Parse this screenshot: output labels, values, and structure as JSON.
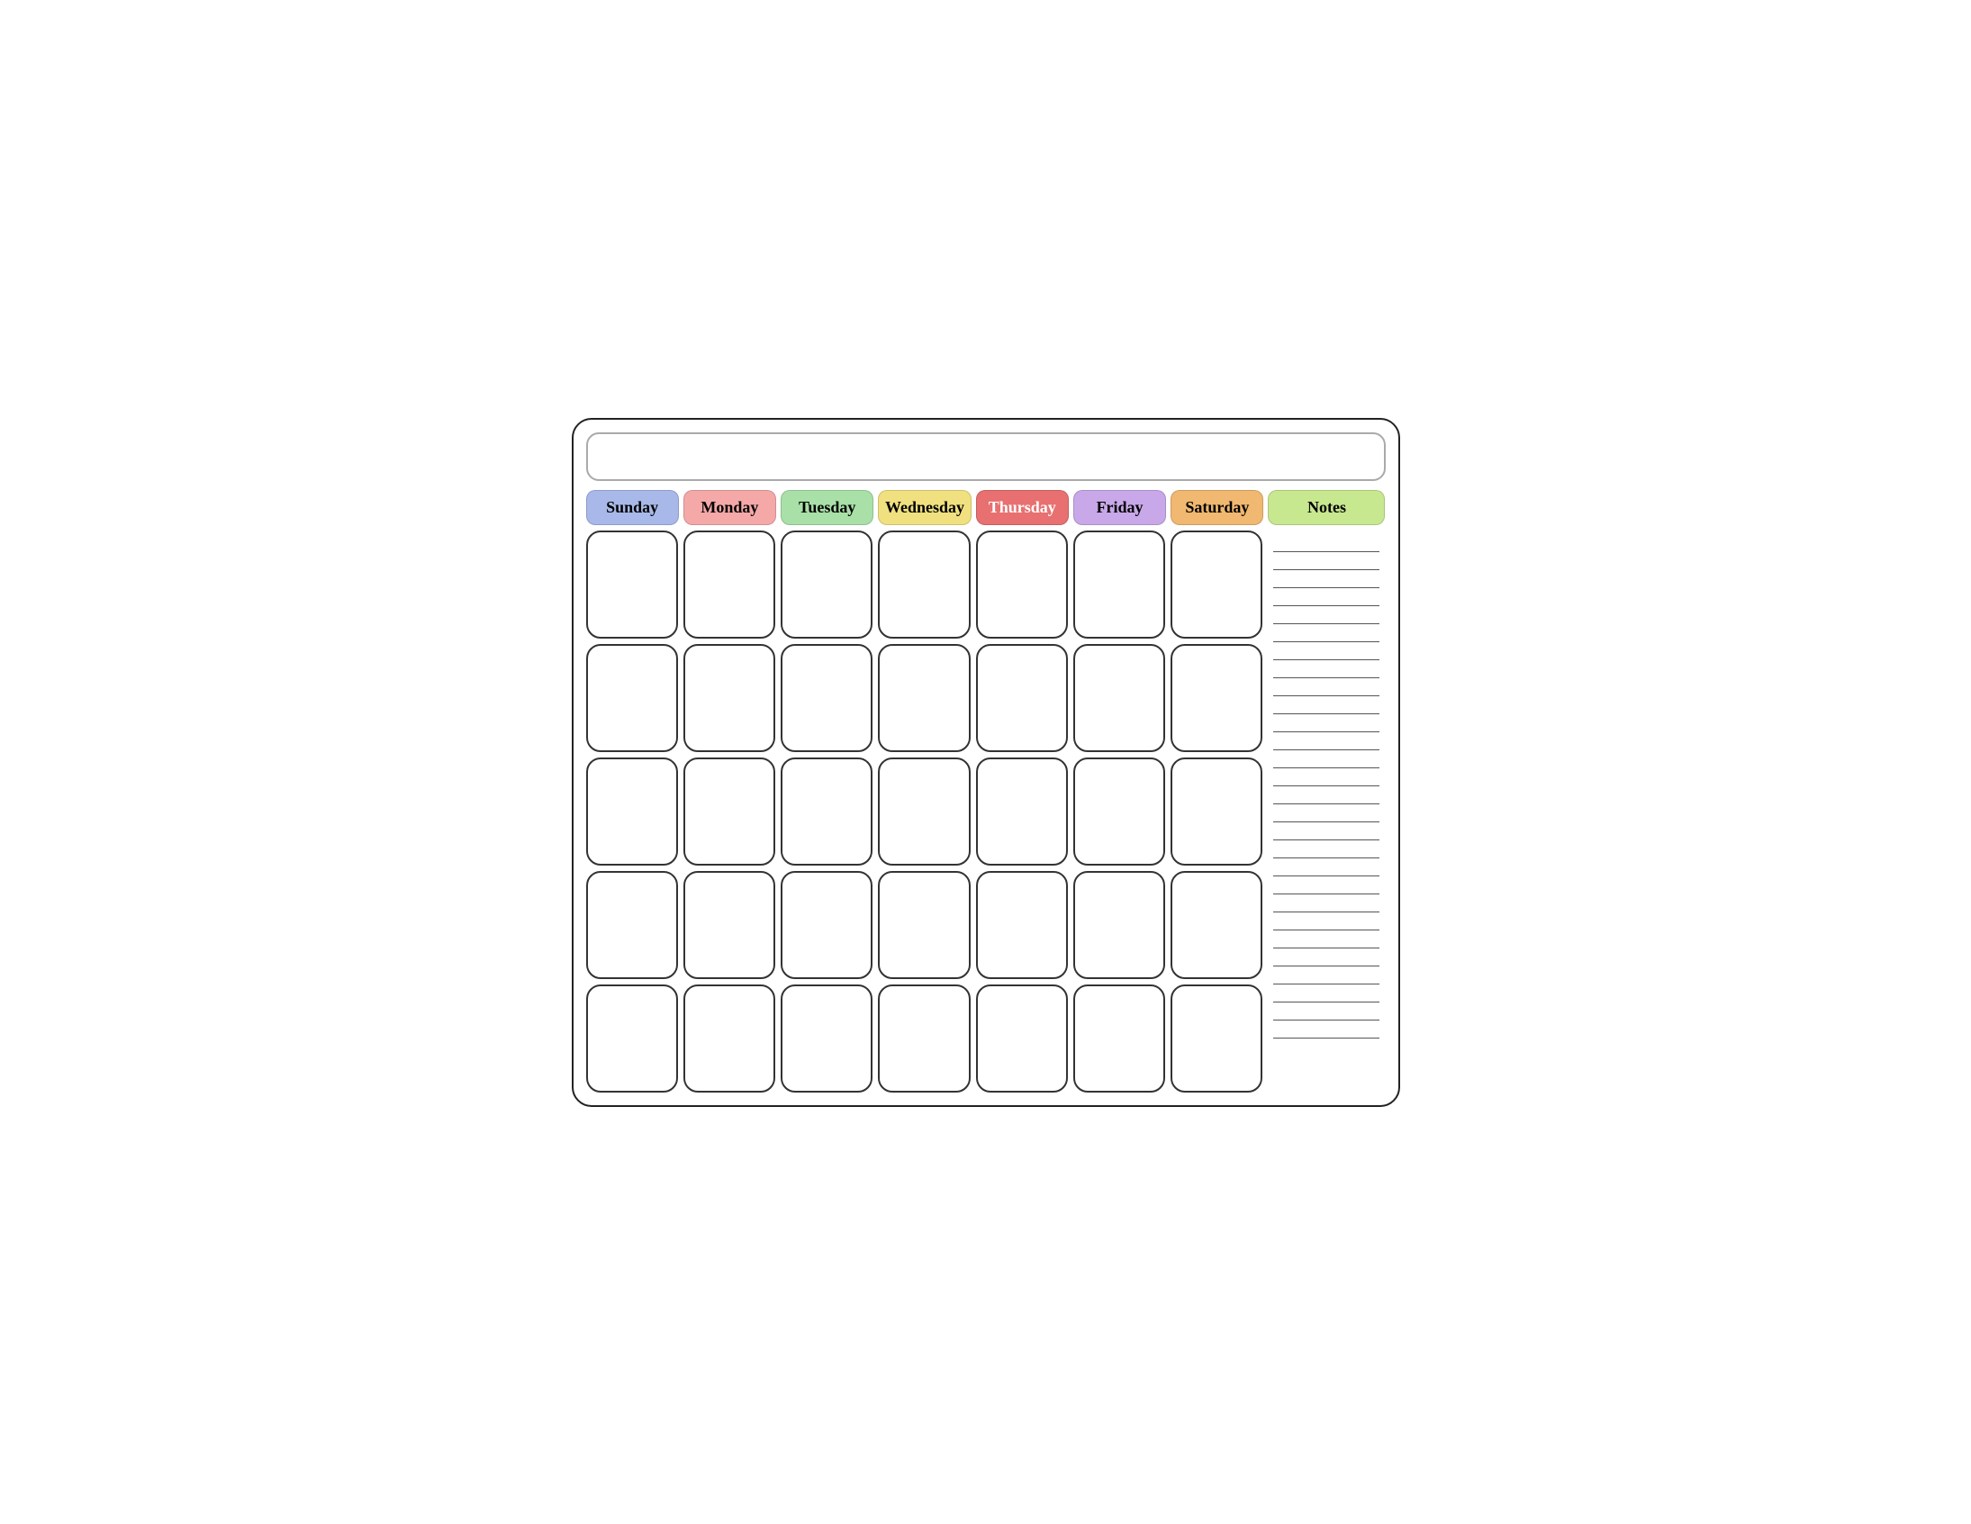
{
  "calendar": {
    "title": "",
    "headers": [
      {
        "id": "sunday",
        "label": "Sunday",
        "class": "day-sunday"
      },
      {
        "id": "monday",
        "label": "Monday",
        "class": "day-monday"
      },
      {
        "id": "tuesday",
        "label": "Tuesday",
        "class": "day-tuesday"
      },
      {
        "id": "wednesday",
        "label": "Wednesday",
        "class": "day-wednesday"
      },
      {
        "id": "thursday",
        "label": "Thursday",
        "class": "day-thursday"
      },
      {
        "id": "friday",
        "label": "Friday",
        "class": "day-friday"
      },
      {
        "id": "saturday",
        "label": "Saturday",
        "class": "day-saturday"
      },
      {
        "id": "notes",
        "label": "Notes",
        "class": "day-notes"
      }
    ],
    "rows": 5,
    "cols": 7,
    "notes_lines": 28
  }
}
